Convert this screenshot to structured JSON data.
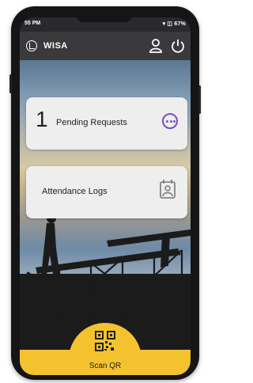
{
  "status_bar": {
    "time": "55 PM",
    "right_text": "▾ ◫ 67%"
  },
  "app_bar": {
    "title": "WISA",
    "logo_icon": "lt-logo-icon",
    "profile_icon": "user-icon",
    "logout_icon": "power-icon"
  },
  "cards": [
    {
      "count": "1",
      "label": "Pending Requests",
      "icon": "more-icon",
      "accent": "#7b4fbf"
    },
    {
      "label": "Attendance Logs",
      "icon": "calendar-person-icon"
    }
  ],
  "bottom": {
    "scan_label": "Scan QR",
    "scan_icon": "qr-code-icon",
    "accent": "#f4c22f"
  }
}
